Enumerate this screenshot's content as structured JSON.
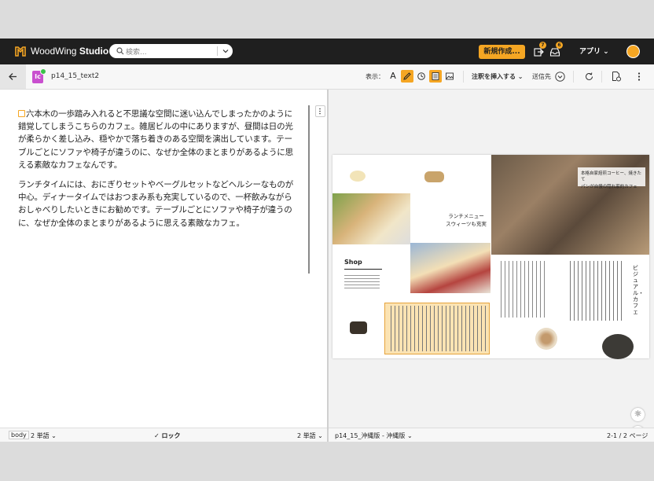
{
  "app": {
    "logo_text_light": "WoodWing",
    "logo_text_bold": "Studio",
    "search_placeholder": "検索...",
    "new_button": "新規作成...",
    "badge_1": "7",
    "badge_2": "6",
    "apps_label": "アプリ",
    "accent": "#f5a623"
  },
  "toolbar": {
    "doc_icon_letter": "Ic",
    "doc_name": "p14_15_text2",
    "view_label": "表示：",
    "view_text_letter": "A",
    "insert_note": "注釈を挿入する",
    "send_to": "送信先"
  },
  "editor": {
    "paragraphs": [
      "六本木の一歩踏み入れると不思議な空間に迷い込んでしまったかのように錯覚してしまうこちらのカフェ。雑居ビルの中にありますが、昼間は日の光が柔らかく差し込み、穏やかで落ち着きのある空間を演出しています。テーブルごとにソファや椅子が違うのに、なぜか全体のまとまりがあるように思える素敵なカフェなんです。",
      "ランチタイムには、おにぎりセットやベーグルセットなどヘルシーなものが中心。ディナータイムではおつまみ系も充実しているので、一杯飲みながらおしゃべりしたいときにお勧めです。テーブルごとにソファや椅子が違うのに、なぜか全体のまとまりがあるように思える素敵なカフェ。"
    ]
  },
  "preview": {
    "shop_title": "Shop",
    "lunch_title_1": "ランチメニュー",
    "lunch_title_2": "スウィーツも充実",
    "photo_caption_1": "本格自家焙煎コーヒー、焼きたて",
    "photo_caption_2": "パンが自慢の隠れ家的カフェ",
    "vertical_title": "ビジュアル・カフェ"
  },
  "status": {
    "style_tag": "body",
    "word_count_left": "2 単語",
    "lock_label": "ロック",
    "word_count_right": "2 単語",
    "layout_name": "p14_15_沖縄版 - 沖縄版",
    "page_info": "2-1 / 2 ページ"
  }
}
